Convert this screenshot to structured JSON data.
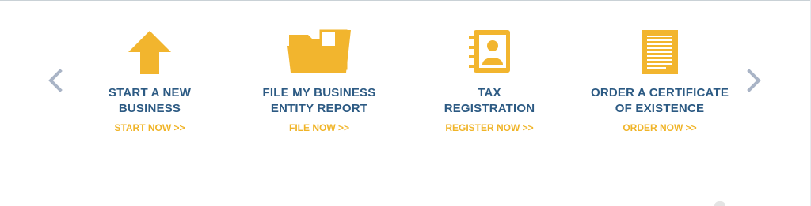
{
  "carousel": {
    "prev_icon": "chevron-left-icon",
    "next_icon": "chevron-right-icon",
    "items": [
      {
        "icon": "arrow-up-icon",
        "title_line1": "START A NEW",
        "title_line2": "BUSINESS",
        "cta": "START NOW >>"
      },
      {
        "icon": "folder-icon",
        "title_line1": "FILE MY BUSINESS",
        "title_line2": "ENTITY REPORT",
        "cta": "FILE NOW >>"
      },
      {
        "icon": "address-book-icon",
        "title_line1": "TAX",
        "title_line2": "REGISTRATION",
        "cta": "REGISTER NOW >>"
      },
      {
        "icon": "document-icon",
        "title_line1": "ORDER A CERTIFICATE",
        "title_line2": "OF EXISTENCE",
        "cta": "ORDER NOW >>"
      }
    ]
  },
  "colors": {
    "icon": "#f2b52e",
    "title": "#2c5a83",
    "cta": "#f0b428",
    "arrow": "#a9b4c6"
  }
}
